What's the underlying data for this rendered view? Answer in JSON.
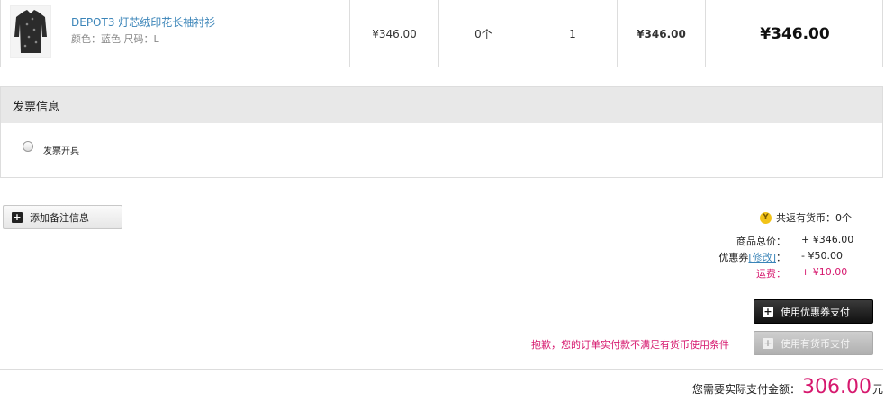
{
  "product": {
    "name": "DEPOT3 灯芯绒印花长袖衬衫",
    "attributes": "颜色：蓝色 尺码：L",
    "unit_price": "¥346.00",
    "coins": "0个",
    "quantity": "1",
    "subtotal": "¥346.00",
    "total": "¥346.00"
  },
  "invoice": {
    "title": "发票信息",
    "option_label": "发票开具"
  },
  "note_button": "添加备注信息",
  "summary": {
    "coins_return_label": "共返有货币：",
    "coins_return_value": "0个",
    "goods_total_label": "商品总价：",
    "goods_total_value": "+ ¥346.00",
    "coupon_label": "优惠券",
    "coupon_link": "[修改]",
    "coupon_colon": "：",
    "coupon_value": "- ¥50.00",
    "shipping_label": "运费：",
    "shipping_value": "+ ¥10.00"
  },
  "pay": {
    "coupon_button": "使用优惠券支付",
    "coin_button": "使用有货币支付",
    "warning": "抱歉，您的订单实付款不满足有货币使用条件"
  },
  "total": {
    "label": "您需要实际支付金额：",
    "amount": "306.00",
    "unit": "元"
  },
  "colors": {
    "accent_pink": "#d6186e",
    "link_blue": "#3a84b8"
  },
  "icons": [
    "shirt-thumbnail",
    "plus-icon",
    "coin-icon"
  ]
}
